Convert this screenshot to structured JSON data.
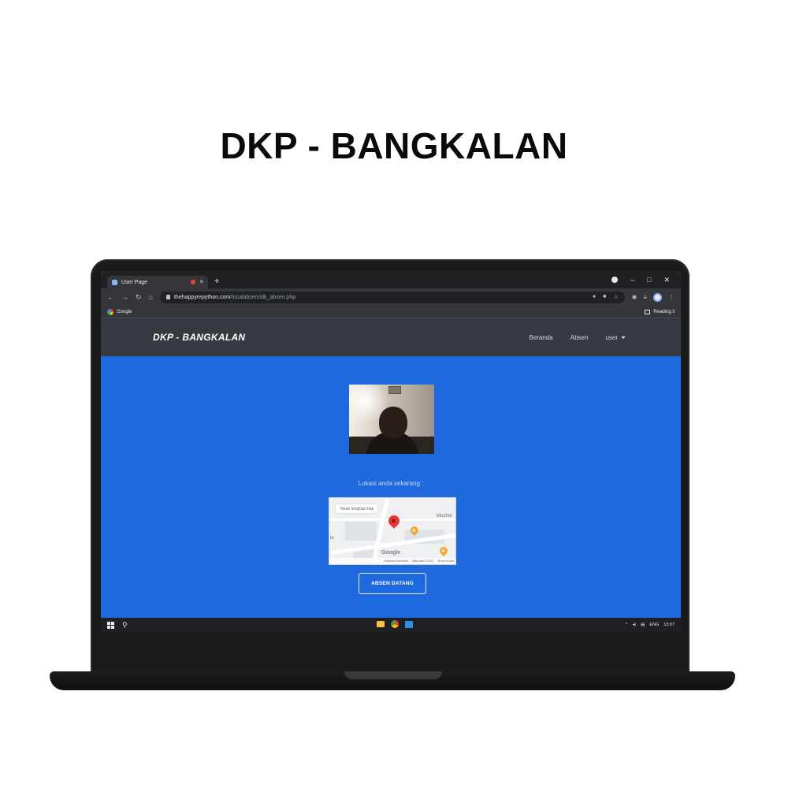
{
  "page": {
    "heading": "DKP - BANGKALAN"
  },
  "browser": {
    "tab_title": "User Page",
    "tab_close": "×",
    "new_tab": "+",
    "url_host": "thehappyrepython.com",
    "url_path": "/localabsen/idk_absen.php",
    "bookmark": "Google",
    "reading_list": "Reading li"
  },
  "site": {
    "brand": "DKP - BANGKALAN",
    "nav": {
      "home": "Beranda",
      "absen": "Absen",
      "user": "user"
    },
    "location_label": "Lokasi anda sekarang :",
    "map": {
      "button": "Tekan lengkap map",
      "place": "Mushol",
      "edge": "lo",
      "google": "Google",
      "footer": [
        "Keyboard shortcuts",
        "Map data ©2022",
        "Terms of Use"
      ]
    },
    "absen_button": "ABSEN DATANG"
  },
  "taskbar": {
    "lang": "ENG",
    "time": "13:07"
  },
  "colors": {
    "page_bg": "#1f69de",
    "navbar_bg": "#343a40",
    "chrome_dark": "#202124"
  }
}
